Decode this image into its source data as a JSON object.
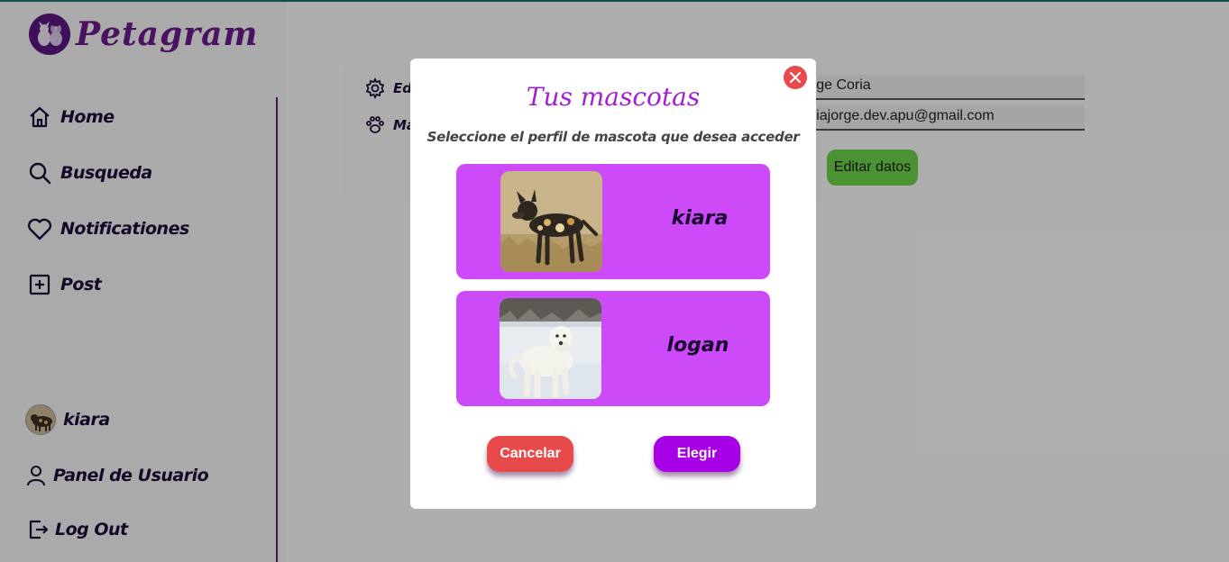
{
  "app": {
    "logo_text": "Petagram"
  },
  "sidebar": {
    "items": [
      {
        "label": "Home",
        "icon": "home-icon"
      },
      {
        "label": "Busqueda",
        "icon": "search-icon"
      },
      {
        "label": "Notificationes",
        "icon": "heart-icon"
      },
      {
        "label": "Post",
        "icon": "plus-square-icon"
      }
    ],
    "bottom": [
      {
        "label": "kiara",
        "icon": "avatar"
      },
      {
        "label": "Panel de Usuario",
        "icon": "user-icon"
      },
      {
        "label": "Log Out",
        "icon": "logout-icon"
      }
    ]
  },
  "profile_card": {
    "menu": [
      {
        "label": "Edi",
        "icon": "gear-icon"
      },
      {
        "label": "Ma",
        "icon": "paw-icon"
      }
    ],
    "name_value": "orge Coria",
    "email_value": "oriajorge.dev.apu@gmail.com",
    "edit_button": "Editar datos"
  },
  "modal": {
    "title": "Tus mascotas",
    "subtitle": "Seleccione el perfil de mascota que desea acceder",
    "pets": [
      {
        "name": "kiara",
        "image": "african-wild-dog-photo"
      },
      {
        "name": "logan",
        "image": "white-dog-in-snow-photo"
      }
    ],
    "cancel_button": "Cancelar",
    "choose_button": "Elegir",
    "close_icon": "close-icon"
  },
  "colors": {
    "brand_purple": "#5b1780",
    "pet_card": "#cc4af7",
    "title_purple": "#a31fd1",
    "cancel_red": "#e84a4a",
    "choose_purple": "#a800e6",
    "edit_green": "#6bd24a"
  }
}
